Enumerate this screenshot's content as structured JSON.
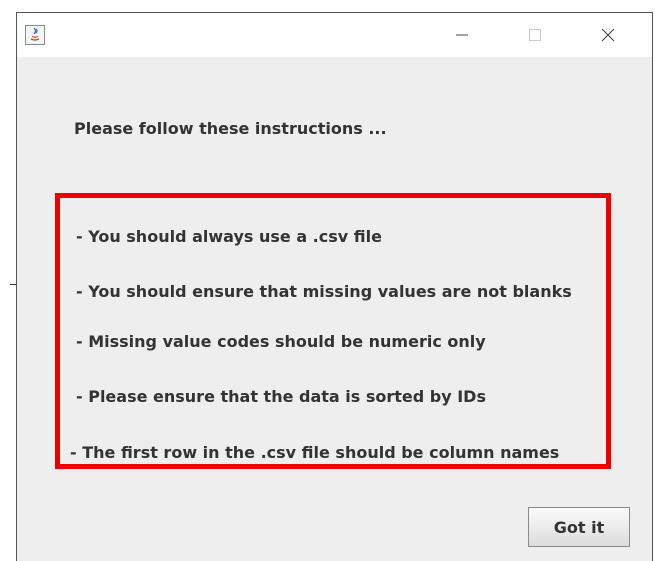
{
  "window": {
    "controls": {
      "minimize_icon": "minimize-icon",
      "maximize_icon": "maximize-icon",
      "close_icon": "close-icon"
    }
  },
  "dialog": {
    "heading": "Please follow these instructions ...",
    "instructions": [
      "- You should always use a .csv file",
      "- You should ensure that missing values are not blanks",
      "- Missing value codes should be numeric only",
      "- Please ensure that the data is sorted by IDs",
      "- The first row in the .csv file should be column names"
    ],
    "button_label": "Got it"
  },
  "colors": {
    "highlight_border": "#ee0000",
    "background": "#eeeeee"
  }
}
